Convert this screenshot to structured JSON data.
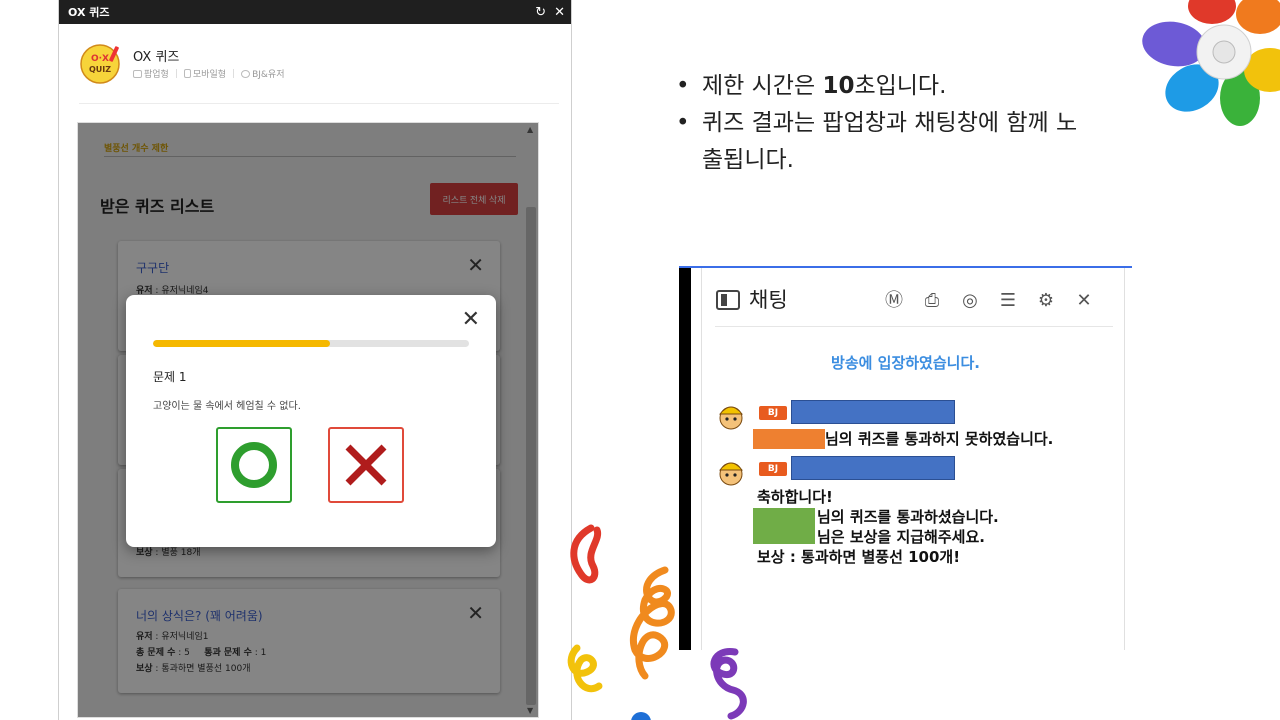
{
  "popup": {
    "title": "OX 퀴즈",
    "refresh_icon": "refresh-icon",
    "close_icon": "close-icon",
    "app_title": "OX 퀴즈",
    "tabs": [
      "팝업형",
      "모바일형",
      "BJ&유저"
    ],
    "limit_label": "별풍선 개수 제한",
    "list_title": "받은 퀴즈 리스트",
    "delete_all_label": "리스트 전체 삭제",
    "cards": [
      {
        "title": "구구단",
        "user_label": "유저",
        "user": "유저닉네임4"
      },
      {
        "reward_label": "보상",
        "reward": "별풍 18개"
      },
      {
        "title": "너의 상식은? (꽤 어려움)",
        "user_label": "유저",
        "user": "유저닉네임1",
        "total_label": "총 문제 수",
        "total": "5",
        "pass_label": "통과 문제 수",
        "pass": "1",
        "reward_label": "보상",
        "reward": "통과하면 별풍선 100개"
      }
    ]
  },
  "modal": {
    "progress": 0.56,
    "question_number": "문제 1",
    "question_text": "고양이는 물 속에서 헤엄칠 수 없다.",
    "answer_o": "O",
    "answer_x": "X",
    "colors": {
      "progress": "#f5b800",
      "o": "#2e9e2e",
      "x": "#b01c1c"
    }
  },
  "bullets": [
    {
      "pre": "제한 시간은 ",
      "bold": "10",
      "post": "초입니다."
    },
    {
      "line1": "퀴즈 결과는 팝업창과 채팅창에 함께 노",
      "line2": "출됩니다."
    }
  ],
  "chat": {
    "title": "채팅",
    "tool_icons": [
      "m-badge-icon",
      "bookmark-icon",
      "donation-icon",
      "user-list-icon",
      "gear-icon",
      "close-icon"
    ],
    "enter_message": "방송에 입장하였습니다.",
    "bj_badge": "BJ",
    "messages": [
      {
        "line1": "님의 퀴즈를 통과하지 못하였습니다."
      },
      {
        "line1": "축하합니다!",
        "line2": "님의 퀴즈를 통과하셨습니다.",
        "line3": "님은 보상을 지급해주세요.",
        "line4": "보상 : 통과하면 별풍선 100개!"
      }
    ]
  }
}
